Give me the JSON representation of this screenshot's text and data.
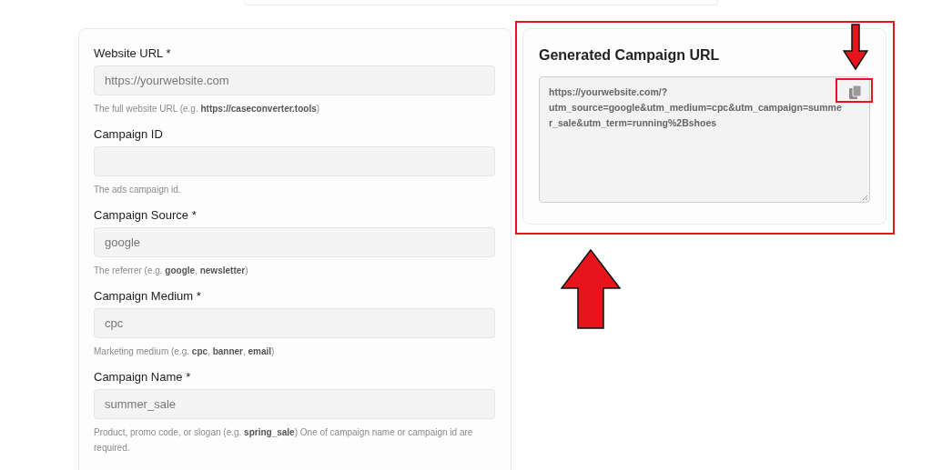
{
  "form": {
    "fields": [
      {
        "label": "Website URL *",
        "placeholder": "https://yourwebsite.com",
        "hint": "The full website URL (e.g. **https://caseconverter.tools**)"
      },
      {
        "label": "Campaign ID",
        "hint": "The ads campaign id."
      },
      {
        "label": "Campaign Source *",
        "placeholder": "google",
        "hint": "The referrer (e.g. **google**, **newsletter**)"
      },
      {
        "label": "Campaign Medium *",
        "placeholder": "cpc",
        "hint": "Marketing medium (e.g. **cpc**, **banner**, **email**)"
      },
      {
        "label": "Campaign Name *",
        "placeholder": "summer_sale",
        "hint": "Product, promo code, or slogan (e.g. **spring_sale**) One of campaign name or campaign id are required."
      }
    ]
  },
  "result": {
    "title": "Generated Campaign URL",
    "value": "https://yourwebsite.com/?utm_source=google&utm_medium=cpc&utm_campaign=summer_sale&utm_term=running%2Bshoes"
  },
  "annotations": [
    {
      "kind": "cardframe"
    },
    {
      "kind": "copyframe"
    },
    {
      "kind": "smallarrow"
    },
    {
      "kind": "largearrow"
    }
  ]
}
